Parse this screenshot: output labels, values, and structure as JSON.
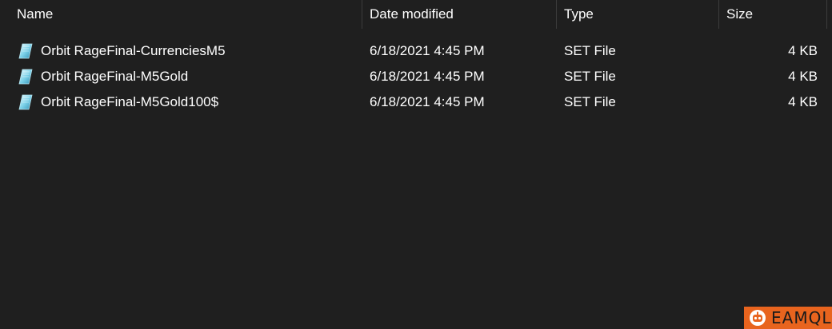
{
  "columns": {
    "name": "Name",
    "date_modified": "Date modified",
    "type": "Type",
    "size": "Size"
  },
  "files": [
    {
      "name": "Orbit RageFinal-CurrenciesM5",
      "date_modified": "6/18/2021 4:45 PM",
      "type": "SET File",
      "size": "4 KB",
      "icon": "set-file-icon"
    },
    {
      "name": "Orbit RageFinal-M5Gold",
      "date_modified": "6/18/2021 4:45 PM",
      "type": "SET File",
      "size": "4 KB",
      "icon": "set-file-icon"
    },
    {
      "name": "Orbit RageFinal-M5Gold100$",
      "date_modified": "6/18/2021 4:45 PM",
      "type": "SET File",
      "size": "4 KB",
      "icon": "set-file-icon"
    }
  ],
  "watermark": {
    "text": "EAMQL"
  },
  "colors": {
    "background": "#1f1f1f",
    "text": "#ffffff",
    "divider": "#3c3c3c",
    "watermark_bg": "#e8641e"
  }
}
